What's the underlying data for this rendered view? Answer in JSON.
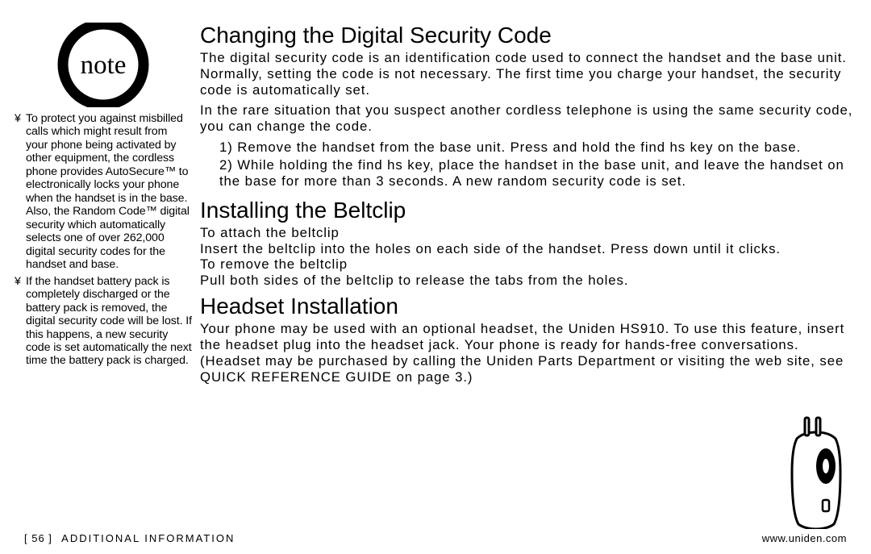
{
  "note_icon": {
    "label": "note"
  },
  "sidebar": {
    "bullets": [
      "To protect you against misbilled calls which might result from your phone being activated by other equipment, the cordless phone provides AutoSecure™ to electronically locks your phone when the handset is in the base. Also, the Random Code™ digital security which automatically selects one of over 262,000 digital security codes for the handset and base.",
      "If the handset battery pack is completely discharged or the battery pack is removed, the digital security code will be lost. If this happens, a new security code is set automatically the next time the battery pack is charged."
    ]
  },
  "section1": {
    "title": "Changing the Digital Security Code",
    "p1": "The digital security code is an identification code used to connect the handset and the base unit. Normally, setting the code is not necessary. The first time you charge your handset, the security code is automatically set.",
    "p2": "In the rare situation that you suspect another cordless telephone is using the same security code, you can change the code.",
    "step1_a": "Remove the handset from the base unit. Press and hold the ",
    "step1_b": "find hs",
    "step1_c": " key on the base.",
    "step2_a": "While holding the ",
    "step2_b": "find hs",
    "step2_c": " key, place the handset in the base unit, and leave the handset on the base for more than 3 seconds. A new random security code is set."
  },
  "section2": {
    "title": "Installing the Beltclip",
    "attach_label": "To attach the beltclip",
    "attach_text": "Insert the beltclip into the holes on each side of the handset. Press down until it clicks.",
    "remove_label": "To remove the beltclip",
    "remove_text": "Pull both sides of the beltclip to release the tabs from the holes."
  },
  "section3": {
    "title": "Headset Installation",
    "p1": "Your phone may be used with an optional headset, the Uniden HS910. To use this feature, insert the headset plug into the headset jack. Your phone is ready for hands-free conversations.",
    "p2": "(Headset may be purchased by calling the Uniden Parts Department or visiting the web site, see QUICK REFERENCE GUIDE on page 3.)"
  },
  "footer": {
    "page": "[ 56 ]",
    "section": "ADDITIONAL INFORMATION",
    "url": "www.uniden.com"
  }
}
